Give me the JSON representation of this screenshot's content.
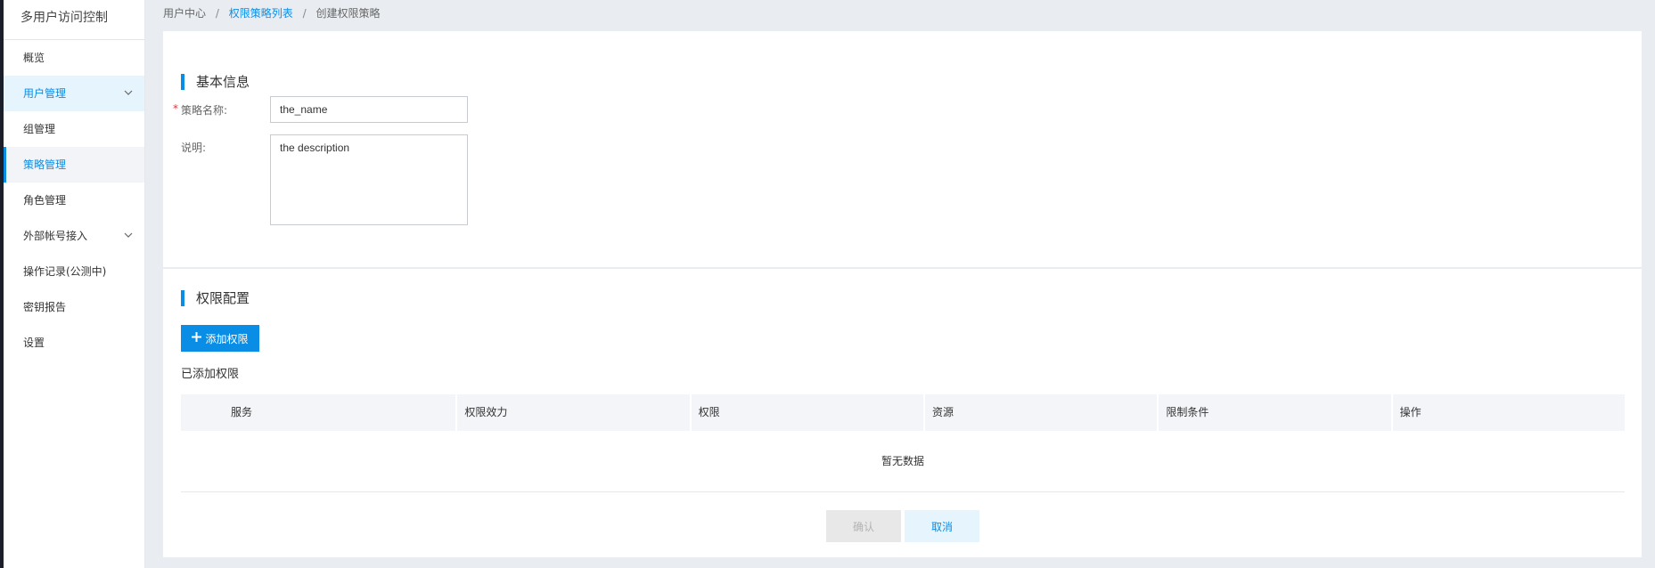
{
  "sidebar": {
    "title": "多用户访问控制",
    "items": [
      {
        "label": "概览"
      },
      {
        "label": "用户管理"
      },
      {
        "label": "组管理"
      },
      {
        "label": "策略管理"
      },
      {
        "label": "角色管理"
      },
      {
        "label": "外部帐号接入"
      },
      {
        "label": "操作记录(公测中)"
      },
      {
        "label": "密钥报告"
      },
      {
        "label": "设置"
      }
    ]
  },
  "breadcrumb": {
    "home": "用户中心",
    "sep": "/",
    "list": "权限策略列表",
    "current": "创建权限策略"
  },
  "basic": {
    "title": "基本信息",
    "name_label": "策略名称:",
    "required_mark": "*",
    "name_value": "the_name",
    "desc_label": "说明:",
    "desc_value": "the description"
  },
  "perm": {
    "title": "权限配置",
    "add_button": "添加权限",
    "added_title": "已添加权限",
    "columns": [
      "服务",
      "权限效力",
      "权限",
      "资源",
      "限制条件",
      "操作"
    ],
    "empty_text": "暂无数据",
    "confirm_button": "确认",
    "cancel_button": "取消"
  },
  "colors": {
    "accent": "#0a8de4",
    "required": "#e3333c",
    "background": "#e9edf2"
  }
}
